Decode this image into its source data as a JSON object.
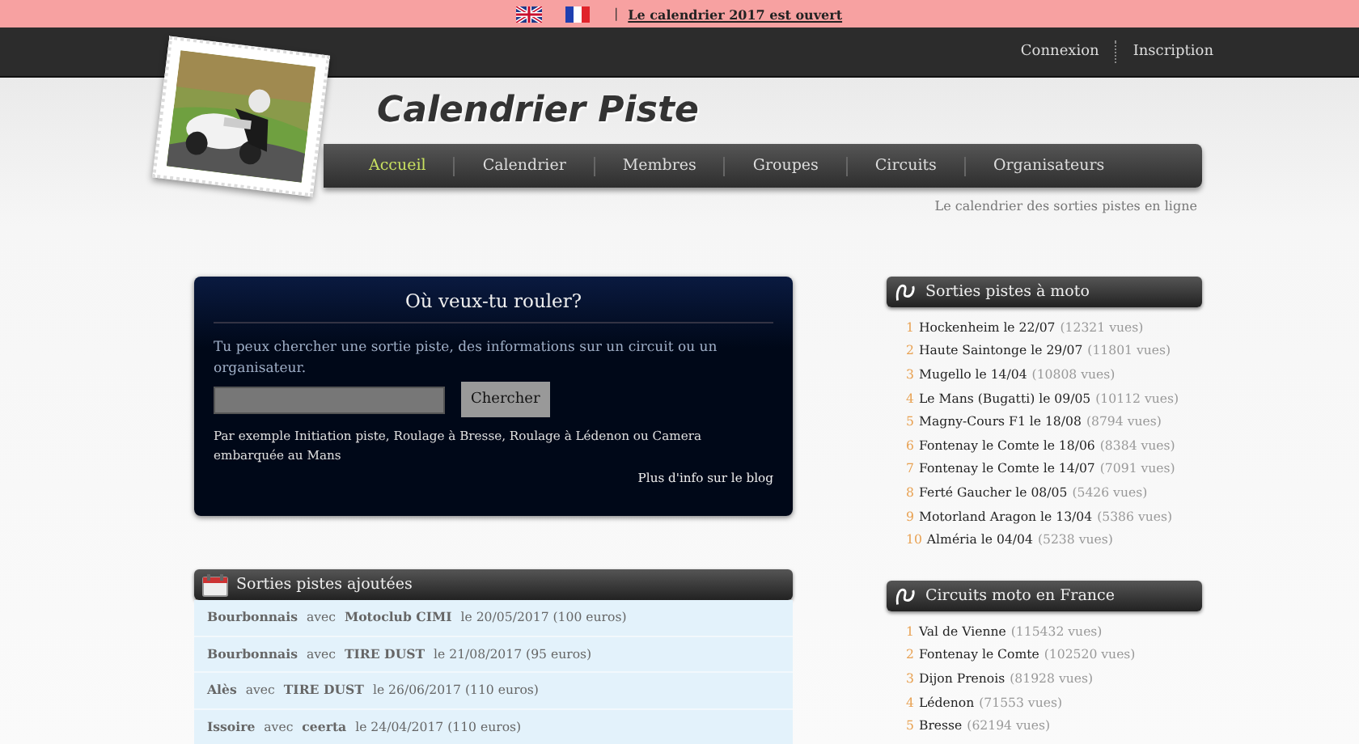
{
  "top_bar": {
    "announcement": "Le calendrier 2017 est ouvert",
    "separator": "|"
  },
  "account_links": [
    "Connexion",
    "Inscription"
  ],
  "header": {
    "title": "Calendrier Piste",
    "tagline": "Le calendrier des sorties pistes en ligne"
  },
  "nav": [
    {
      "label": "Accueil",
      "selected": true
    },
    {
      "label": "Calendrier",
      "selected": false
    },
    {
      "label": "Membres",
      "selected": false
    },
    {
      "label": "Groupes",
      "selected": false
    },
    {
      "label": "Circuits",
      "selected": false
    },
    {
      "label": "Organisateurs",
      "selected": false
    }
  ],
  "search_panel": {
    "title": "Où veux-tu rouler?",
    "description": "Tu peux chercher une sortie piste, des informations sur un circuit ou un organisateur.",
    "button": "Chercher",
    "examples": "Par exemple Initiation piste, Roulage à Bresse, Roulage à Lédenon ou Camera embarquée au Mans",
    "blog_link": "Plus d'info sur le blog"
  },
  "added_panel": {
    "title": "Sorties pistes ajoutées",
    "rows": [
      "**Bourbonnais** avec **Motoclub CIMI** le 20/05/2017 (100 euros)",
      "**Bourbonnais** avec **TIRE DUST** le 21/08/2017 (95 euros)",
      "**Alès** avec **TIRE DUST** le 26/06/2017 (110 euros)",
      "**Issoire** avec **ceerta** le 24/04/2017 (110 euros)"
    ]
  },
  "popular_panel": {
    "title": "Sorties pistes à moto",
    "items": [
      {
        "rank": "1",
        "name": "Hockenheim le 22/07",
        "views": "(12321 vues)"
      },
      {
        "rank": "2",
        "name": "Haute Saintonge le 29/07",
        "views": "(11801 vues)"
      },
      {
        "rank": "3",
        "name": "Mugello le 14/04",
        "views": "(10808 vues)"
      },
      {
        "rank": "4",
        "name": "Le Mans (Bugatti) le 09/05",
        "views": "(10112 vues)"
      },
      {
        "rank": "5",
        "name": "Magny-Cours F1 le 18/08",
        "views": "(8794 vues)"
      },
      {
        "rank": "6",
        "name": "Fontenay le Comte le 18/06",
        "views": "(8384 vues)"
      },
      {
        "rank": "7",
        "name": "Fontenay le Comte le 14/07",
        "views": "(7091 vues)"
      },
      {
        "rank": "8",
        "name": "Ferté Gaucher le 08/05",
        "views": "(5426 vues)"
      },
      {
        "rank": "9",
        "name": "Motorland Aragon le 13/04",
        "views": "(5386 vues)"
      },
      {
        "rank": "10",
        "name": "Alméria le 04/04",
        "views": "(5238 vues)"
      }
    ]
  },
  "circuits_panel": {
    "title": "Circuits moto en France",
    "items": [
      {
        "rank": "1",
        "name": "Val de Vienne",
        "views": "(115432 vues)"
      },
      {
        "rank": "2",
        "name": "Fontenay le Comte",
        "views": "(102520 vues)"
      },
      {
        "rank": "3",
        "name": "Dijon Prenois",
        "views": "(81928 vues)"
      },
      {
        "rank": "4",
        "name": "Lédenon",
        "views": "(71553 vues)"
      },
      {
        "rank": "5",
        "name": "Bresse",
        "views": "(62194 vues)"
      }
    ]
  }
}
